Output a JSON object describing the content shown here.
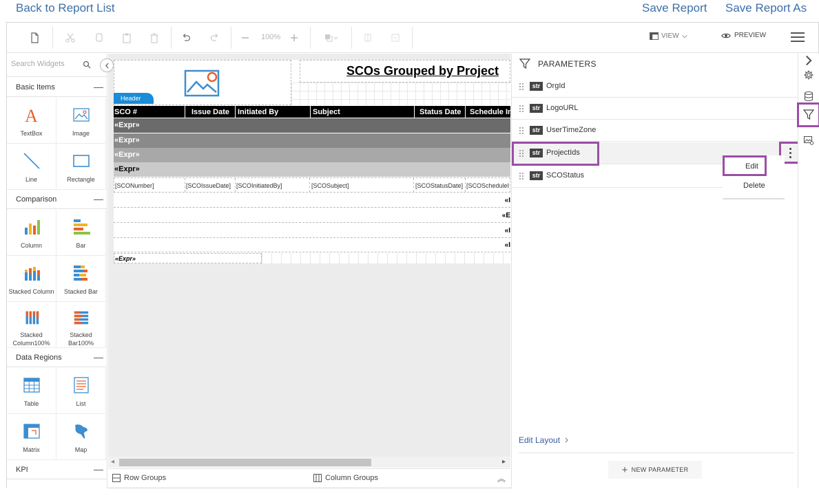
{
  "top": {
    "back_link": "Back to Report List",
    "save_link": "Save Report",
    "save_as_link": "Save Report As"
  },
  "toolbar": {
    "zoom": "100%",
    "view_label": "VIEW",
    "preview_label": "PREVIEW"
  },
  "widgets": {
    "search_placeholder": "Search Widgets",
    "categories": {
      "basic": "Basic Items",
      "comparison": "Comparison",
      "data_regions": "Data Regions",
      "kpi": "KPI"
    },
    "items": {
      "textbox": "TextBox",
      "image": "Image",
      "line": "Line",
      "rectangle": "Rectangle",
      "column": "Column",
      "bar": "Bar",
      "stacked_column": "Stacked Column",
      "stacked_bar": "Stacked Bar",
      "stacked_column100": "Stacked Column100%",
      "stacked_bar100": "Stacked Bar100%",
      "table": "Table",
      "list": "List",
      "matrix": "Matrix",
      "map": "Map"
    }
  },
  "report": {
    "title": "SCOs Grouped by Project",
    "header_tab": "Header",
    "columns": [
      "SCO #",
      "Issue Date",
      "Initiated By",
      "Subject",
      "Status Date",
      "Schedule In"
    ],
    "group_expr": "«Expr»",
    "detail": [
      "[SCONumber]",
      "[SCOIssueDate]",
      "[SCOInitiatedBy]",
      "[SCOSubject]",
      "[SCOStatusDate]",
      "[SCOScheduleI"
    ],
    "footer_expr": [
      "«I",
      "«E",
      "«I",
      "«I"
    ],
    "page_footer_expr": "«Expr»"
  },
  "groups_bar": {
    "row_groups": "Row Groups",
    "column_groups": "Column Groups"
  },
  "parameters": {
    "title": "PARAMETERS",
    "items": [
      {
        "type": "str",
        "name": "OrgId"
      },
      {
        "type": "str",
        "name": "LogoURL"
      },
      {
        "type": "str",
        "name": "UserTimeZone"
      },
      {
        "type": "str",
        "name": "ProjectIds"
      },
      {
        "type": "str",
        "name": "SCOStatus"
      }
    ],
    "menu": {
      "edit": "Edit",
      "delete": "Delete"
    },
    "edit_layout": "Edit Layout",
    "new_parameter": "NEW PARAMETER"
  },
  "colors": {
    "accent_link": "#3d6fa8",
    "highlight": "#9b4ea6",
    "header_tab": "#1a8cd8"
  }
}
